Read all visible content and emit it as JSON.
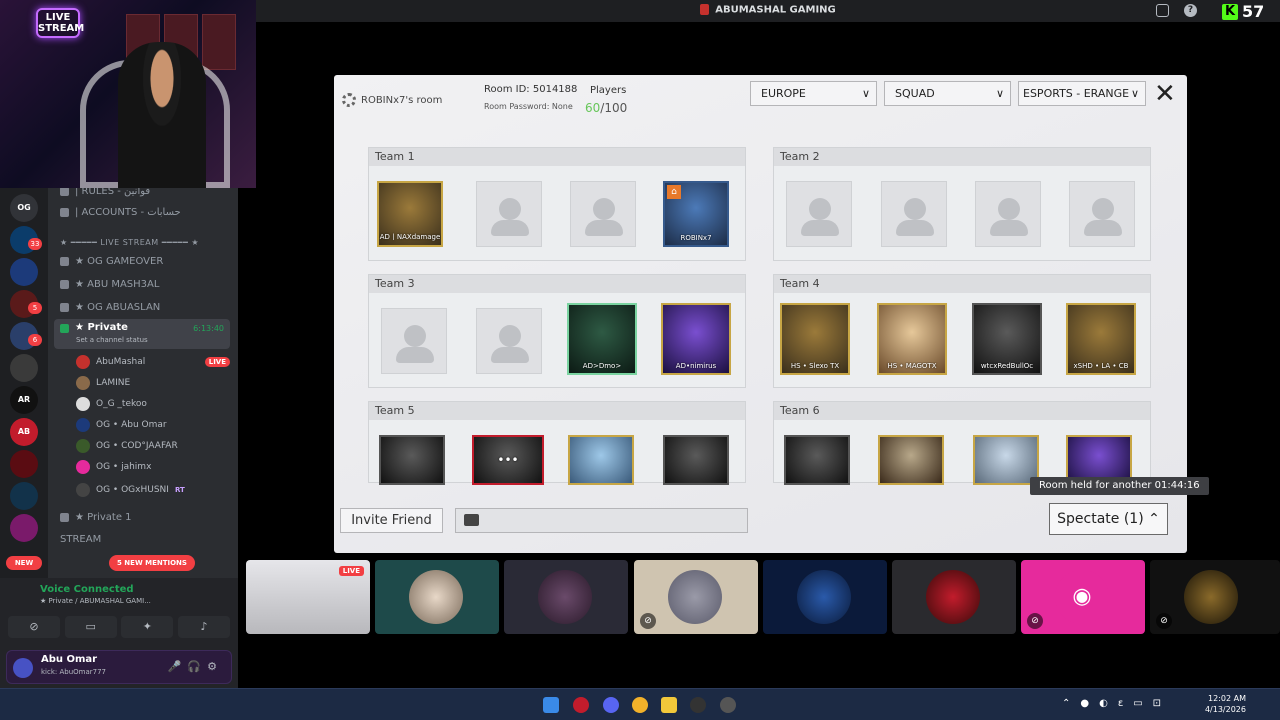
{
  "window": {
    "title": "ABUMASHAL GAMING"
  },
  "kick": {
    "viewers": "57"
  },
  "stream_overlay": {
    "badge": "LIVE STREAM"
  },
  "servers": [
    {
      "badge": "33"
    },
    {
      "badge": "5"
    },
    {
      "badge": "6"
    }
  ],
  "new_badge": "NEW",
  "channels": {
    "rules": "| RULES - قوانين",
    "accounts": "| ACCOUNTS - حسابات",
    "category": "★ ━━━━━ LIVE STREAM ━━━━━ ★",
    "gameover": "★ OG GAMEOVER",
    "abumash": "★ ABU MASH3AL",
    "abuaslan": "★ OG ABUASLAN",
    "private": {
      "name": "★ Private",
      "time": "6:13:40",
      "status": "Set a channel status"
    },
    "private1": "★ Private 1",
    "stream": "STREAM"
  },
  "voice_users": [
    {
      "name": "AbuMashal",
      "live": "LIVE"
    },
    {
      "name": "LAMINE"
    },
    {
      "name": "O_G _tekoo"
    },
    {
      "name": "OG • Abu Omar"
    },
    {
      "name": "OG • COD°JAAFAR"
    },
    {
      "name": "OG • jahimx"
    },
    {
      "name": "OG • OGxHUSNI",
      "tag": "RT"
    }
  ],
  "mentions": "5 NEW MENTIONS",
  "voice": {
    "status": "Voice Connected",
    "location": "★ Private / ABUMASHAL GAMI..."
  },
  "user": {
    "name": "Abu Omar",
    "status": "kick: AbuOmar777"
  },
  "room": {
    "name": "ROBINx7's room",
    "id": "Room ID: 5014188",
    "password": "Room Password: None",
    "players_label": "Players",
    "players_current": "60",
    "players_max": "/100"
  },
  "filters": {
    "region": "EUROPE",
    "mode": "SQUAD",
    "map": "ESPORTS - ERANGEL"
  },
  "teams": [
    {
      "name": "Team 1",
      "players": [
        "AD丨NAXdamage",
        "",
        "",
        "ROBINx7"
      ]
    },
    {
      "name": "Team 2",
      "players": [
        "",
        "",
        "",
        ""
      ]
    },
    {
      "name": "Team 3",
      "players": [
        "",
        "",
        "AD>Dmo>",
        "AD•nimirus"
      ]
    },
    {
      "name": "Team 4",
      "players": [
        "HS • Slexo TX",
        "HS • MAGOTX",
        "wtcxRedBullOc",
        "xSHD • LA • CB"
      ]
    },
    {
      "name": "Team 5",
      "players": [
        "",
        "",
        "",
        ""
      ]
    },
    {
      "name": "Team 6",
      "players": [
        "",
        "",
        "",
        ""
      ]
    }
  ],
  "footer": {
    "invite": "Invite Friend",
    "spectate": "Spectate (1)"
  },
  "tooltip": "Room held for another 01:44:16",
  "tiles": [
    {
      "live": "LIVE"
    }
  ],
  "clock": {
    "time": "12:02 AM",
    "date": "4/13/2026"
  },
  "colors": {
    "accent": "#53fc18",
    "discord": "#e62a9c",
    "players_green": "#67c65a"
  }
}
